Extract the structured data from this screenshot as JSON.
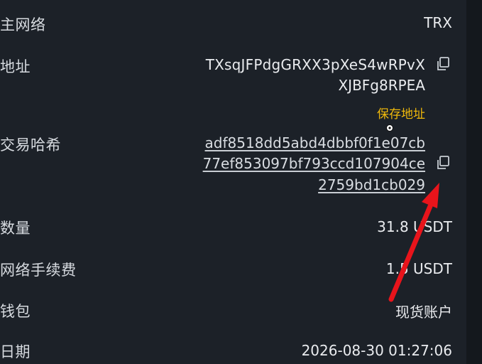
{
  "rows": {
    "network": {
      "label": "主网络",
      "value": "TRX"
    },
    "address": {
      "label": "地址",
      "line1": "TXsqJFPdgGRXX3pXeS4wRPvX",
      "line2": "XJBFg8RPEA",
      "save_link": "保存地址"
    },
    "tx_hash": {
      "label": "交易哈希",
      "line1": "adf8518dd5abd4dbbf0f1e07cb",
      "line2": "77ef853097bf793ccd107904ce",
      "line3": "2759bd1cb029"
    },
    "amount": {
      "label": "数量",
      "value": "31.8 USDT"
    },
    "fee": {
      "label": "网络手续费",
      "value": "1.5 USDT"
    },
    "wallet": {
      "label": "钱包",
      "value": "现货账户"
    },
    "date": {
      "label": "日期",
      "value": "2026-08-30 01:27:06"
    }
  },
  "icons": {
    "copy": "copy-icon",
    "cursor": "mouse-cursor-icon",
    "annotation": "red-arrow-annotation"
  },
  "colors": {
    "background": "#1c2128",
    "text": "#eaecef",
    "accent": "#f0b90b",
    "annotation": "#e8141b"
  }
}
